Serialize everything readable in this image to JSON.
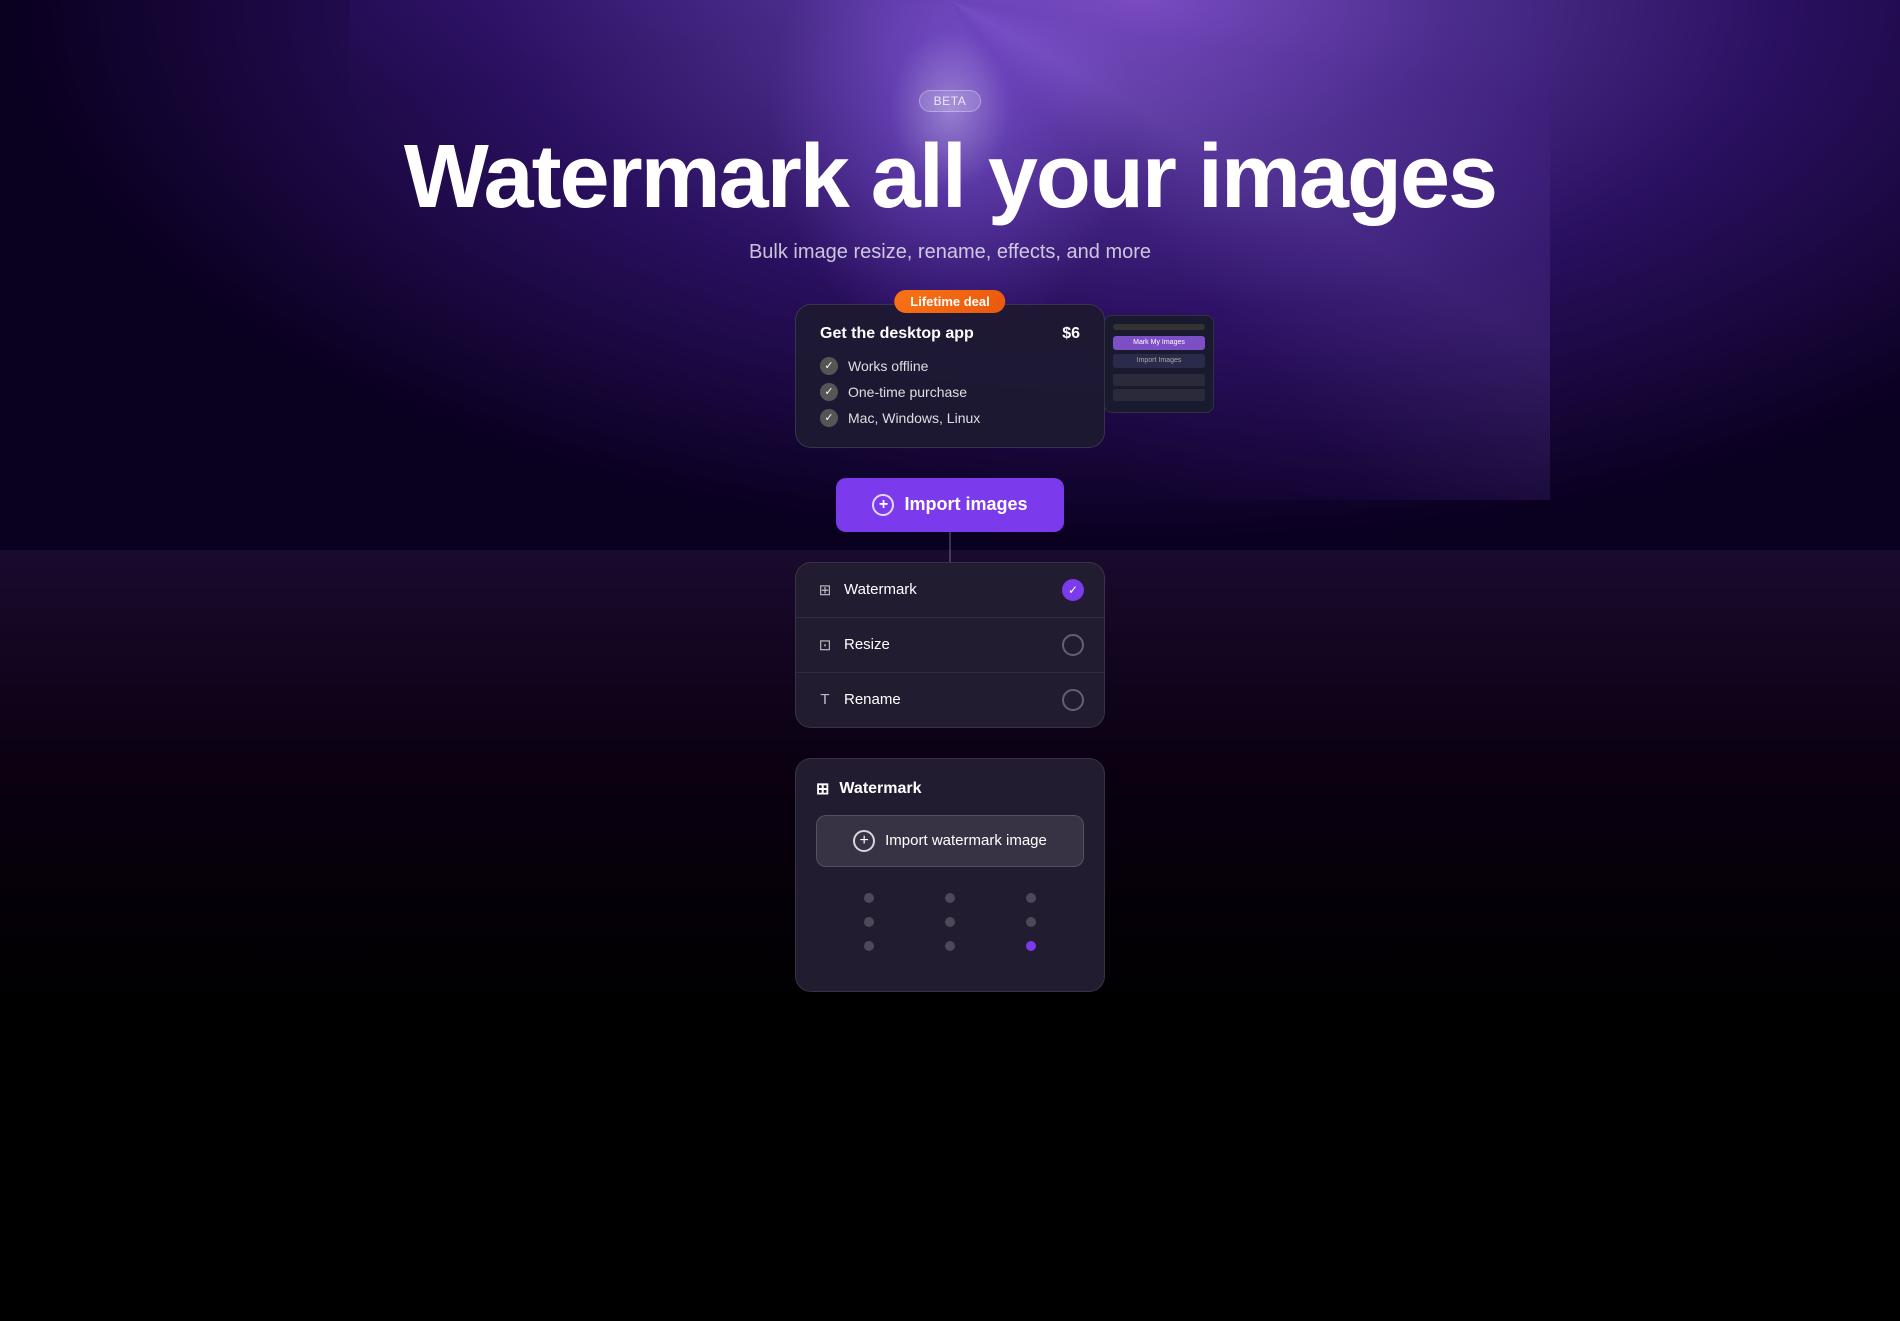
{
  "hero": {
    "beta_label": "BETA",
    "title": "Watermark all your images",
    "subtitle": "Bulk image resize, rename, effects, and more"
  },
  "promo_card": {
    "lifetime_badge": "Lifetime deal",
    "title": "Get the desktop app",
    "price": "$6",
    "features": [
      {
        "label": "Works offline"
      },
      {
        "label": "One-time purchase"
      },
      {
        "label": "Mac, Windows, Linux"
      }
    ]
  },
  "import_button": {
    "label": "Import images",
    "icon": "+"
  },
  "options": {
    "items": [
      {
        "icon": "watermark",
        "label": "Watermark",
        "active": true
      },
      {
        "icon": "resize",
        "label": "Resize",
        "active": false
      },
      {
        "icon": "rename",
        "label": "Rename",
        "active": false
      }
    ]
  },
  "watermark_section": {
    "title": "Watermark",
    "import_button_label": "Import watermark image",
    "grid_dots": [
      {
        "active": false
      },
      {
        "active": false
      },
      {
        "active": false
      },
      {
        "active": false
      },
      {
        "active": false
      },
      {
        "active": false
      },
      {
        "active": false
      },
      {
        "active": false
      },
      {
        "active": true
      }
    ]
  }
}
